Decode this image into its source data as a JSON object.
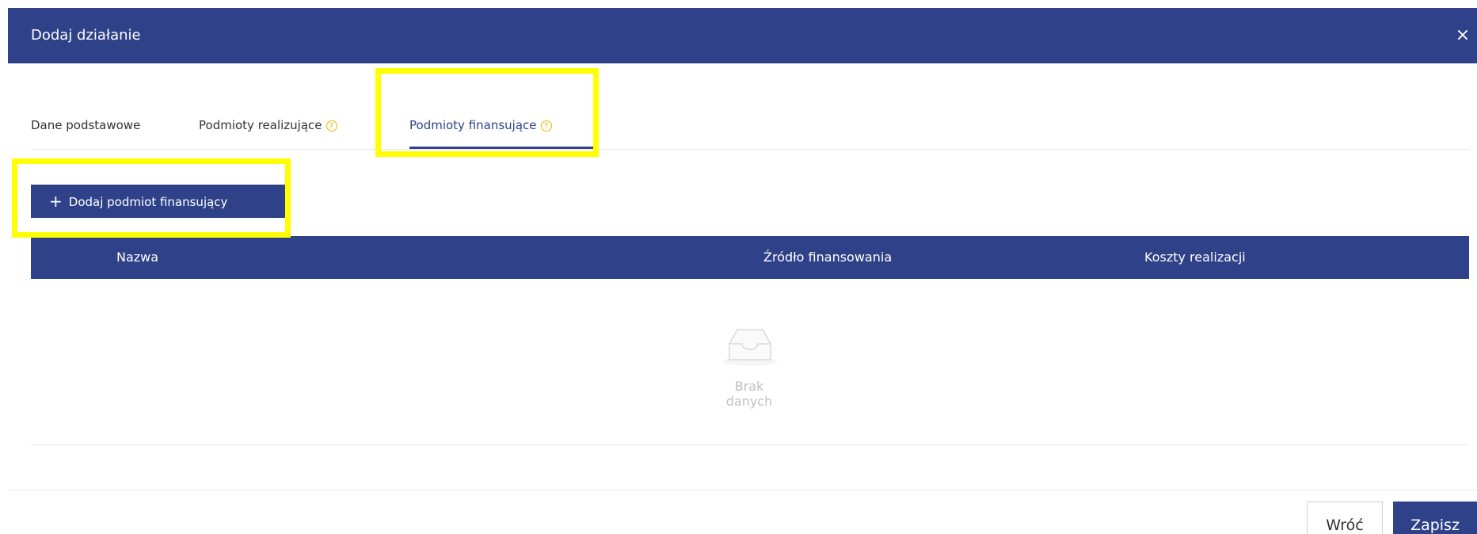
{
  "modal": {
    "title": "Dodaj działanie",
    "close_symbol": "×",
    "close_icon": "close-icon"
  },
  "tabs": [
    {
      "label": "Dane podstawowe",
      "help": false,
      "active": false
    },
    {
      "label": "Podmioty realizujące",
      "help": true,
      "active": false
    },
    {
      "label": "Podmioty finansujące",
      "help": true,
      "active": true
    }
  ],
  "help_symbol": "?",
  "add_button": {
    "icon": "plus-icon",
    "symbol": "+",
    "label": "Dodaj podmiot finansujący"
  },
  "table": {
    "columns": [
      "Nazwa",
      "Źródło finansowania",
      "Koszty realizacji"
    ],
    "rows": [],
    "empty_icon": "empty-inbox-icon",
    "empty_text": "Brak danych"
  },
  "footer": {
    "back_label": "Wróć",
    "save_label": "Zapisz"
  },
  "colors": {
    "primary": "#2f4289",
    "highlight": "#ffff00",
    "help": "#f0b400",
    "muted": "#bfbfbf"
  }
}
